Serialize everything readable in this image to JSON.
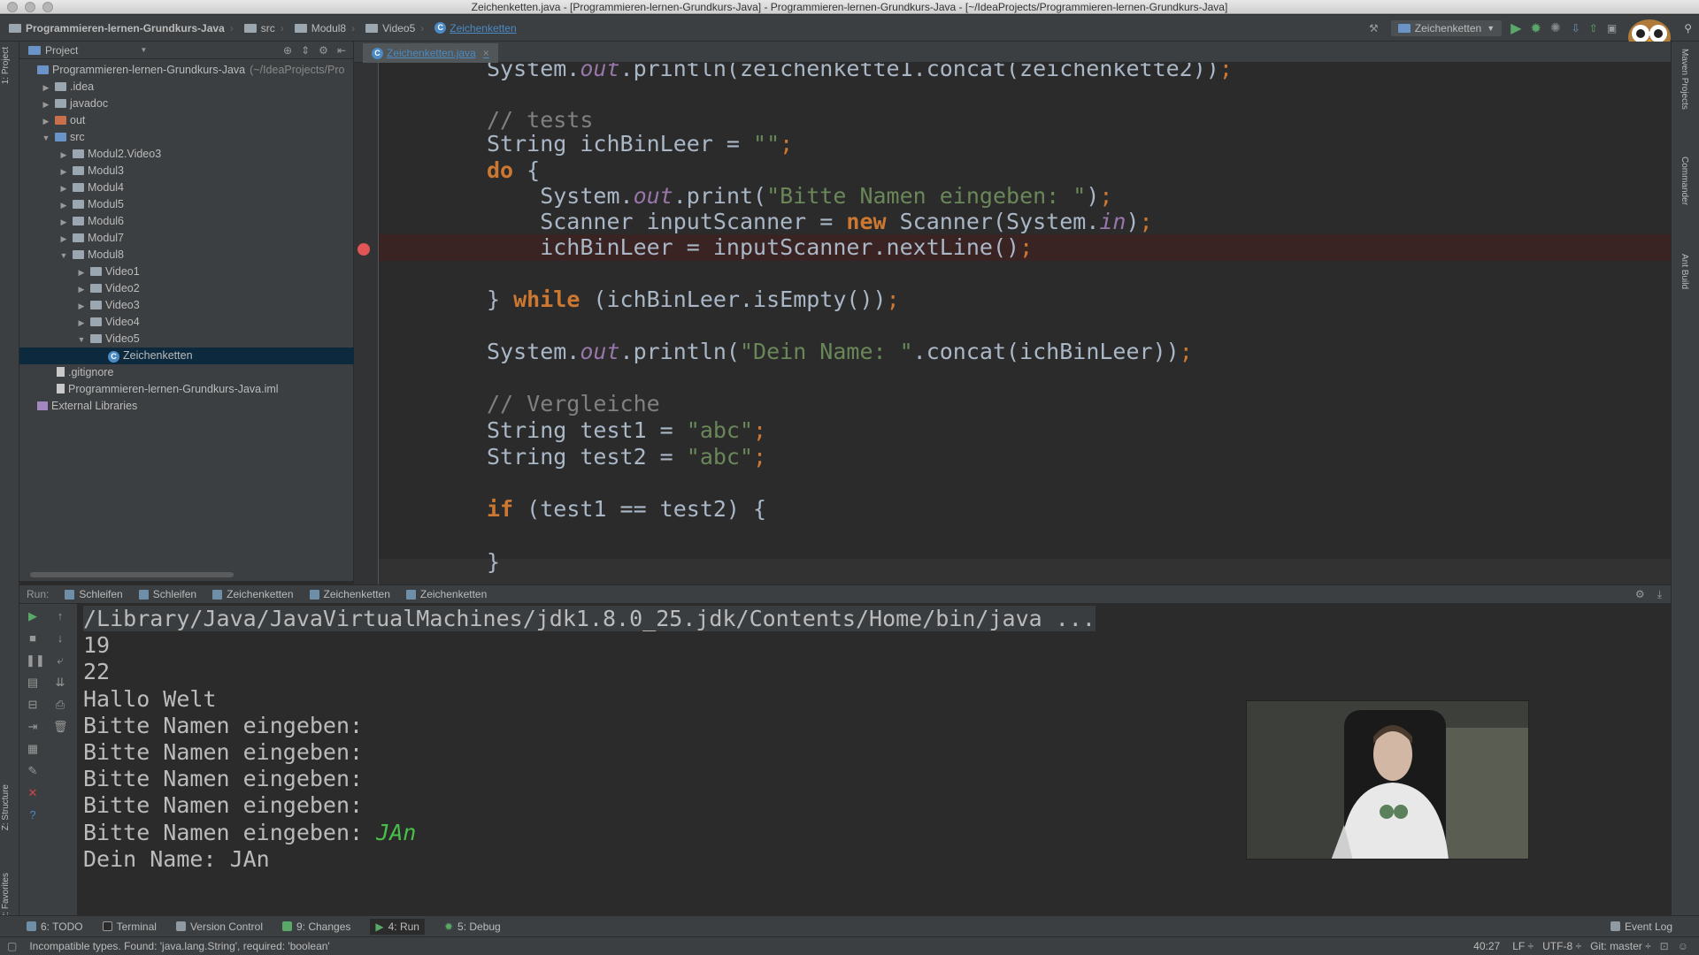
{
  "window": {
    "title": "Zeichenketten.java - [Programmieren-lernen-Grundkurs-Java] - Programmieren-lernen-Grundkurs-Java - [~/IdeaProjects/Programmieren-lernen-Grundkurs-Java]"
  },
  "navbar": {
    "crumbs": [
      "Programmieren-lernen-Grundkurs-Java",
      "src",
      "Modul8",
      "Video5",
      "Zeichenketten"
    ],
    "run_config": "Zeichenketten"
  },
  "left_stripe": {
    "project_tab": "1: Project",
    "structure_tab": "Z: Structure",
    "favorites_tab": "2: Favorites"
  },
  "project": {
    "header": "Project",
    "tree": [
      {
        "label": "Programmieren-lernen-Grundkurs-Java",
        "suffix": "(~/IdeaProjects/Pro",
        "depth": 0,
        "arrow": "",
        "icon": "folder-blue"
      },
      {
        "label": ".idea",
        "depth": 1,
        "arrow": "▶",
        "icon": "folder"
      },
      {
        "label": "javadoc",
        "depth": 1,
        "arrow": "▶",
        "icon": "folder"
      },
      {
        "label": "out",
        "depth": 1,
        "arrow": "▶",
        "icon": "folder-red"
      },
      {
        "label": "src",
        "depth": 1,
        "arrow": "▼",
        "icon": "folder-blue"
      },
      {
        "label": "Modul2.Video3",
        "depth": 2,
        "arrow": "▶",
        "icon": "folder"
      },
      {
        "label": "Modul3",
        "depth": 2,
        "arrow": "▶",
        "icon": "folder"
      },
      {
        "label": "Modul4",
        "depth": 2,
        "arrow": "▶",
        "icon": "folder"
      },
      {
        "label": "Modul5",
        "depth": 2,
        "arrow": "▶",
        "icon": "folder"
      },
      {
        "label": "Modul6",
        "depth": 2,
        "arrow": "▶",
        "icon": "folder"
      },
      {
        "label": "Modul7",
        "depth": 2,
        "arrow": "▶",
        "icon": "folder"
      },
      {
        "label": "Modul8",
        "depth": 2,
        "arrow": "▼",
        "icon": "folder"
      },
      {
        "label": "Video1",
        "depth": 3,
        "arrow": "▶",
        "icon": "folder"
      },
      {
        "label": "Video2",
        "depth": 3,
        "arrow": "▶",
        "icon": "folder"
      },
      {
        "label": "Video3",
        "depth": 3,
        "arrow": "▶",
        "icon": "folder"
      },
      {
        "label": "Video4",
        "depth": 3,
        "arrow": "▶",
        "icon": "folder"
      },
      {
        "label": "Video5",
        "depth": 3,
        "arrow": "▼",
        "icon": "folder"
      },
      {
        "label": "Zeichenketten",
        "depth": 4,
        "arrow": "",
        "icon": "class",
        "selected": true
      },
      {
        "label": ".gitignore",
        "depth": 1,
        "arrow": "",
        "icon": "file"
      },
      {
        "label": "Programmieren-lernen-Grundkurs-Java.iml",
        "depth": 1,
        "arrow": "",
        "icon": "file"
      },
      {
        "label": "External Libraries",
        "depth": 0,
        "arrow": "",
        "icon": "lib"
      }
    ]
  },
  "editor": {
    "tab": "Zeichenketten.java",
    "lines": [
      [
        [
          "plain",
          "System."
        ],
        [
          "fld",
          "out"
        ],
        [
          "plain",
          ".println(zeichenkette1.concat(zeichenkette2))"
        ],
        [
          "semi",
          ";"
        ]
      ],
      [],
      [
        [
          "cmt",
          "// tests"
        ]
      ],
      [
        [
          "plain",
          "String ichBinLeer = "
        ],
        [
          "str",
          "\"\""
        ],
        [
          "semi",
          ";"
        ]
      ],
      [
        [
          "kw",
          "do"
        ],
        [
          "plain",
          " {"
        ]
      ],
      [
        [
          "plain",
          "    System."
        ],
        [
          "fld",
          "out"
        ],
        [
          "plain",
          ".print("
        ],
        [
          "str",
          "\"Bitte Namen eingeben: \""
        ],
        [
          "plain",
          ")"
        ],
        [
          "semi",
          ";"
        ]
      ],
      [
        [
          "plain",
          "    Scanner inputScanner = "
        ],
        [
          "kw",
          "new"
        ],
        [
          "plain",
          " Scanner(System."
        ],
        [
          "fld",
          "in"
        ],
        [
          "plain",
          ")"
        ],
        [
          "semi",
          ";"
        ]
      ],
      [
        [
          "plain",
          "    ichBinLeer = inputScanner.nextLine()"
        ],
        [
          "semi",
          ";"
        ]
      ],
      [],
      [
        [
          "plain",
          "} "
        ],
        [
          "kw",
          "while"
        ],
        [
          "plain",
          " (ichBinLeer.isEmpty())"
        ],
        [
          "semi",
          ";"
        ]
      ],
      [],
      [
        [
          "plain",
          "System."
        ],
        [
          "fld",
          "out"
        ],
        [
          "plain",
          ".println("
        ],
        [
          "str",
          "\"Dein Name: \""
        ],
        [
          "plain",
          ".concat(ichBinLeer))"
        ],
        [
          "semi",
          ";"
        ]
      ],
      [],
      [
        [
          "cmt",
          "// Vergleiche"
        ]
      ],
      [
        [
          "plain",
          "String test1 = "
        ],
        [
          "str",
          "\"abc\""
        ],
        [
          "semi",
          ";"
        ]
      ],
      [
        [
          "plain",
          "String test2 = "
        ],
        [
          "str",
          "\"abc\""
        ],
        [
          "semi",
          ";"
        ]
      ],
      [],
      [
        [
          "kw",
          "if"
        ],
        [
          "plain",
          " (test1 == test2) {"
        ]
      ],
      [],
      [
        [
          "plain",
          "}"
        ]
      ]
    ]
  },
  "run": {
    "label": "Run:",
    "tabs": [
      "Schleifen",
      "Schleifen",
      "Zeichenketten",
      "Zeichenketten",
      "Zeichenketten"
    ],
    "console": [
      {
        "text": "/Library/Java/JavaVirtualMachines/jdk1.8.0_25.jdk/Contents/Home/bin/java ...",
        "input": ""
      },
      {
        "text": "19",
        "input": ""
      },
      {
        "text": "22",
        "input": ""
      },
      {
        "text": "Hallo Welt",
        "input": ""
      },
      {
        "text": "Bitte Namen eingeben:",
        "input": ""
      },
      {
        "text": "Bitte Namen eingeben:",
        "input": ""
      },
      {
        "text": "Bitte Namen eingeben:",
        "input": ""
      },
      {
        "text": "Bitte Namen eingeben:",
        "input": ""
      },
      {
        "text": "Bitte Namen eingeben: ",
        "input": "JAn"
      },
      {
        "text": "Dein Name: JAn",
        "input": ""
      }
    ]
  },
  "toolwindows": {
    "todo": "6: TODO",
    "terminal": "Terminal",
    "vcs": "Version Control",
    "changes": "9: Changes",
    "run": "4: Run",
    "debug": "5: Debug",
    "event_log": "Event Log"
  },
  "right_stripe": {
    "maven": "Maven Projects",
    "commander": "Commander",
    "ant": "Ant Build"
  },
  "status": {
    "message": "Incompatible types. Found: 'java.lang.String', required: 'boolean'",
    "position": "40:27",
    "line_sep": "LF",
    "encoding": "UTF-8",
    "git": "Git: master"
  },
  "colors": {
    "keyword": "#cc7832",
    "string": "#6a8759",
    "comment": "#808080",
    "field": "#9876aa",
    "breakpoint": "#e05555",
    "console_input": "#48c048"
  }
}
